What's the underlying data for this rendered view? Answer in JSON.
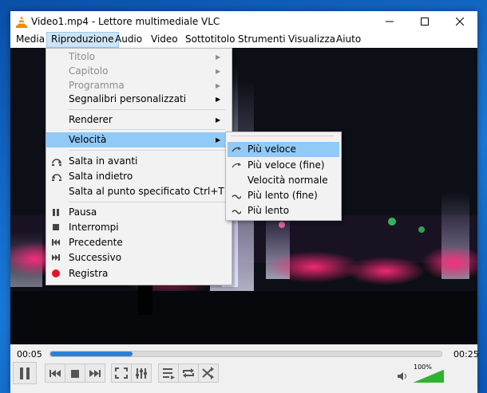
{
  "window": {
    "title": "Video1.mp4 - Lettore multimediale VLC"
  },
  "menubar": [
    "Media",
    "Riproduzione",
    "Audio",
    "Video",
    "Sottotitolo",
    "Strumenti",
    "Visualizza",
    "Aiuto"
  ],
  "dropdown": {
    "items": [
      {
        "label": "Titolo",
        "disabled": true,
        "submenu": true
      },
      {
        "label": "Capitolo",
        "disabled": true,
        "submenu": true
      },
      {
        "label": "Programma",
        "disabled": true,
        "submenu": true
      },
      {
        "label": "Segnalibri personalizzati",
        "submenu": true
      },
      {
        "label": "Renderer",
        "submenu": true
      },
      {
        "label": "Velocità",
        "submenu": true,
        "highlighted": true
      },
      {
        "label": "Salta in avanti",
        "icon": "skip-forward-icon"
      },
      {
        "label": "Salta indietro",
        "icon": "skip-back-icon"
      },
      {
        "label": "Salta al punto specificato",
        "shortcut": "Ctrl+T"
      },
      {
        "label": "Pausa",
        "icon": "pause-icon"
      },
      {
        "label": "Interrompi",
        "icon": "stop-icon"
      },
      {
        "label": "Precedente",
        "icon": "previous-icon"
      },
      {
        "label": "Successivo",
        "icon": "next-icon"
      },
      {
        "label": "Registra",
        "icon": "record-icon"
      }
    ]
  },
  "speed_submenu": [
    {
      "label": "Più veloce",
      "highlighted": true
    },
    {
      "label": "Più veloce (fine)"
    },
    {
      "label": "Velocità normale"
    },
    {
      "label": "Più lento (fine)"
    },
    {
      "label": "Più lento"
    }
  ],
  "player": {
    "time_elapsed": "00:05",
    "time_total": "00:25",
    "progress": 0.21,
    "volume_label": "100%",
    "volume": 1.0
  },
  "colors": {
    "accent": "#2f7fd2",
    "menu_highlight": "#91c9f7",
    "record": "#e81123",
    "volume_green": "#2bb52b"
  }
}
